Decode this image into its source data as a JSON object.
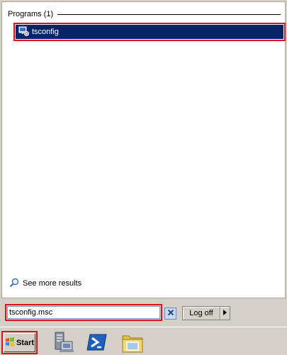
{
  "results": {
    "group_label": "Programs (1)",
    "items": [
      {
        "name": "tsconfig",
        "icon": "tsconfig-icon"
      }
    ],
    "see_more": "See more results"
  },
  "search": {
    "value": "tsconfig.msc",
    "clear_icon": "close-icon"
  },
  "logoff": {
    "label": "Log off"
  },
  "taskbar": {
    "start_label": "Start",
    "pinned": [
      "server-manager-icon",
      "powershell-icon",
      "windows-explorer-icon"
    ]
  },
  "colors": {
    "selection": "#0a246a",
    "highlight_border": "#d9141b",
    "chrome": "#d4d0c8"
  }
}
